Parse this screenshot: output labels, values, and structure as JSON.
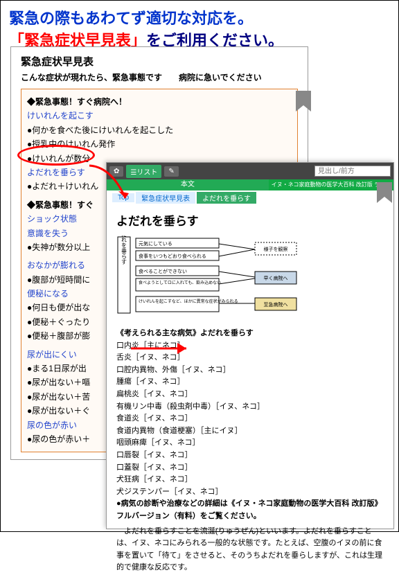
{
  "header": {
    "line1": "緊急の際もあわてず適切な対応を。",
    "line2_red": "「緊急症状早見表」",
    "line2_rest": "をご利用ください。"
  },
  "bg": {
    "title": "緊急症状早見表",
    "subtitle_l": "こんな症状が現れたら、緊急事態です",
    "subtitle_r": "病院に急いでください",
    "s1": "◆緊急事態！すぐ病院へ！",
    "l1": "けいれんを起こす",
    "b1": "●何かを食べた後にけいれんを起こした",
    "b2": "●授乳中のけいれん発作",
    "b3": "●けいれんが数分",
    "l2": "よだれを垂らす",
    "b4": "●よだれ＋けいれん",
    "s2": "◆緊急事態！すぐ",
    "l3": "ショック状態",
    "l4": "意識を失う",
    "b5": "●失神が数分以上",
    "l5": "おなかが膨れる",
    "b6": "●腹部が短時間に",
    "l6": "便秘になる",
    "b7": "●何日も便が出な",
    "b8": "●便秘＋ぐったり",
    "b9": "●便秘＋腹部が膨",
    "l7": "尿が出にくい",
    "b10": "●まる1日尿が出",
    "b11": "●尿が出ない＋嘔",
    "b12": "●尿が出ない＋苦",
    "b13": "●尿が出ない＋ぐ",
    "l8": "尿の色が赤い",
    "b14": "●尿の色が赤い＋"
  },
  "fg": {
    "toolbar": {
      "settings": "✿",
      "list": "☰リスト",
      "pen": "✎",
      "placeholder": "見出し/前方"
    },
    "header": {
      "center": "本文",
      "right": "イヌ・ネコ家庭動物の医学大百科 改訂版 ライト"
    },
    "bc": {
      "top": "Top",
      "mid": "緊急症状早見表",
      "cur": "よだれを垂らす"
    },
    "title": "よだれを垂らす",
    "flow": {
      "vlabel": "よだれを垂らす",
      "r1": "元気にしている",
      "r2": "食事をいつもどおり食べられる",
      "o1": "様子を観察",
      "r3": "食べることができない",
      "r4": "食べようとしてロに入れても、飲み込めない",
      "o2": "早く病院へ",
      "r5": "けいれんを起こすなど、ほかに異常な症状がみられる",
      "o3": "至急病院へ"
    },
    "sec_title": "《考えられる主な病気》よだれを垂らす",
    "items": [
      "口内炎［主にネコ］",
      "舌炎［イヌ、ネコ］",
      "口腔内異物、外傷［イヌ、ネコ］",
      "腫瘍［イヌ、ネコ］",
      "扁桃炎［イヌ、ネコ］",
      "有機リン中毒（殺虫剤中毒）［イヌ、ネコ］",
      "食道炎［イヌ、ネコ］",
      "食道内異物（食道梗塞）［主にイヌ］",
      "咽頭麻痺［イヌ、ネコ］",
      "口唇裂［イヌ、ネコ］",
      "口蓋裂［イヌ、ネコ］",
      "犬狂病［イヌ、ネコ］",
      "犬ジステンパー［イヌ、ネコ］"
    ],
    "note": "●病気の診断や治療などの詳細は《イヌ・ネコ家庭動物の医学大百科 改訂版》フルバージョン（有料）をご覧ください。",
    "para": "　よだれを垂らすことを流涎(りゅうぜん)といいます。よだれを垂らすことは、イヌ、ネコにみられる一般的な状態です。たとえば、空腹のイヌの前に食事を置いて「待て」をさせると、そのうちよだれを垂らしますが、これは生理的で健康な反応です。"
  }
}
